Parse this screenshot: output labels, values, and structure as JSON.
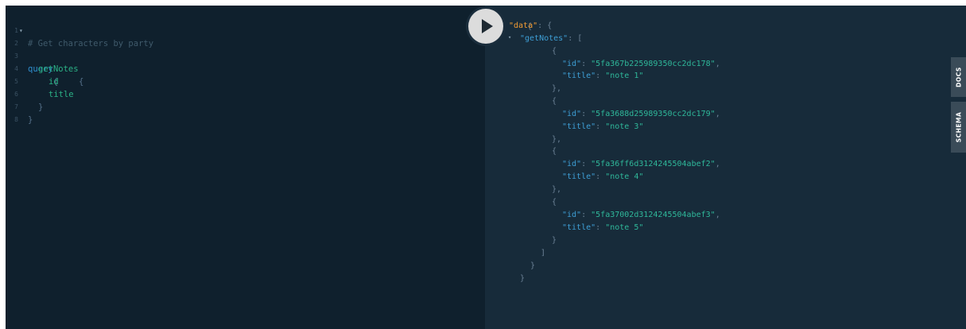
{
  "editor": {
    "line_numbers": [
      "1",
      "2",
      "3",
      "4",
      "5",
      "6",
      "7",
      "8"
    ],
    "fold_marker": "▾",
    "lines": {
      "l1": {
        "comment": "# Get characters by party"
      },
      "l2": {
        "keyword": "query",
        "brace": "{"
      },
      "l3": {
        "field": "getNotes",
        "brace": "{"
      },
      "l4": {
        "field": "id"
      },
      "l5": {
        "field": "title"
      },
      "l6": {
        "brace": "}"
      },
      "l7": {
        "brace": "}"
      }
    }
  },
  "run_button": {
    "icon": "play-icon"
  },
  "result": {
    "fold_marker": "▾",
    "open_brace": "{",
    "close_brace": "}",
    "open_bracket": "[",
    "close_bracket": "]",
    "item_close": "},",
    "colon": ": ",
    "data_key": "\"data\"",
    "get_notes_key": "\"getNotes\"",
    "id_key": "\"id\"",
    "title_key": "\"title\"",
    "comma": ",",
    "notes": [
      {
        "id": "\"5fa367b225989350cc2dc178\"",
        "title": "\"note 1\""
      },
      {
        "id": "\"5fa3688d25989350cc2dc179\"",
        "title": "\"note 3\""
      },
      {
        "id": "\"5fa36ff6d3124245504abef2\"",
        "title": "\"note 4\""
      },
      {
        "id": "\"5fa37002d3124245504abef3\"",
        "title": "\"note 5\""
      }
    ]
  },
  "side_tabs": {
    "docs": "DOCS",
    "schema": "SCHEMA"
  },
  "colors": {
    "editor_bg": "#0f202d",
    "result_bg": "#172b3a",
    "keyword": "#2f8ecf",
    "field": "#2bb286",
    "data_key": "#f39c33",
    "string": "#2fb89a"
  }
}
